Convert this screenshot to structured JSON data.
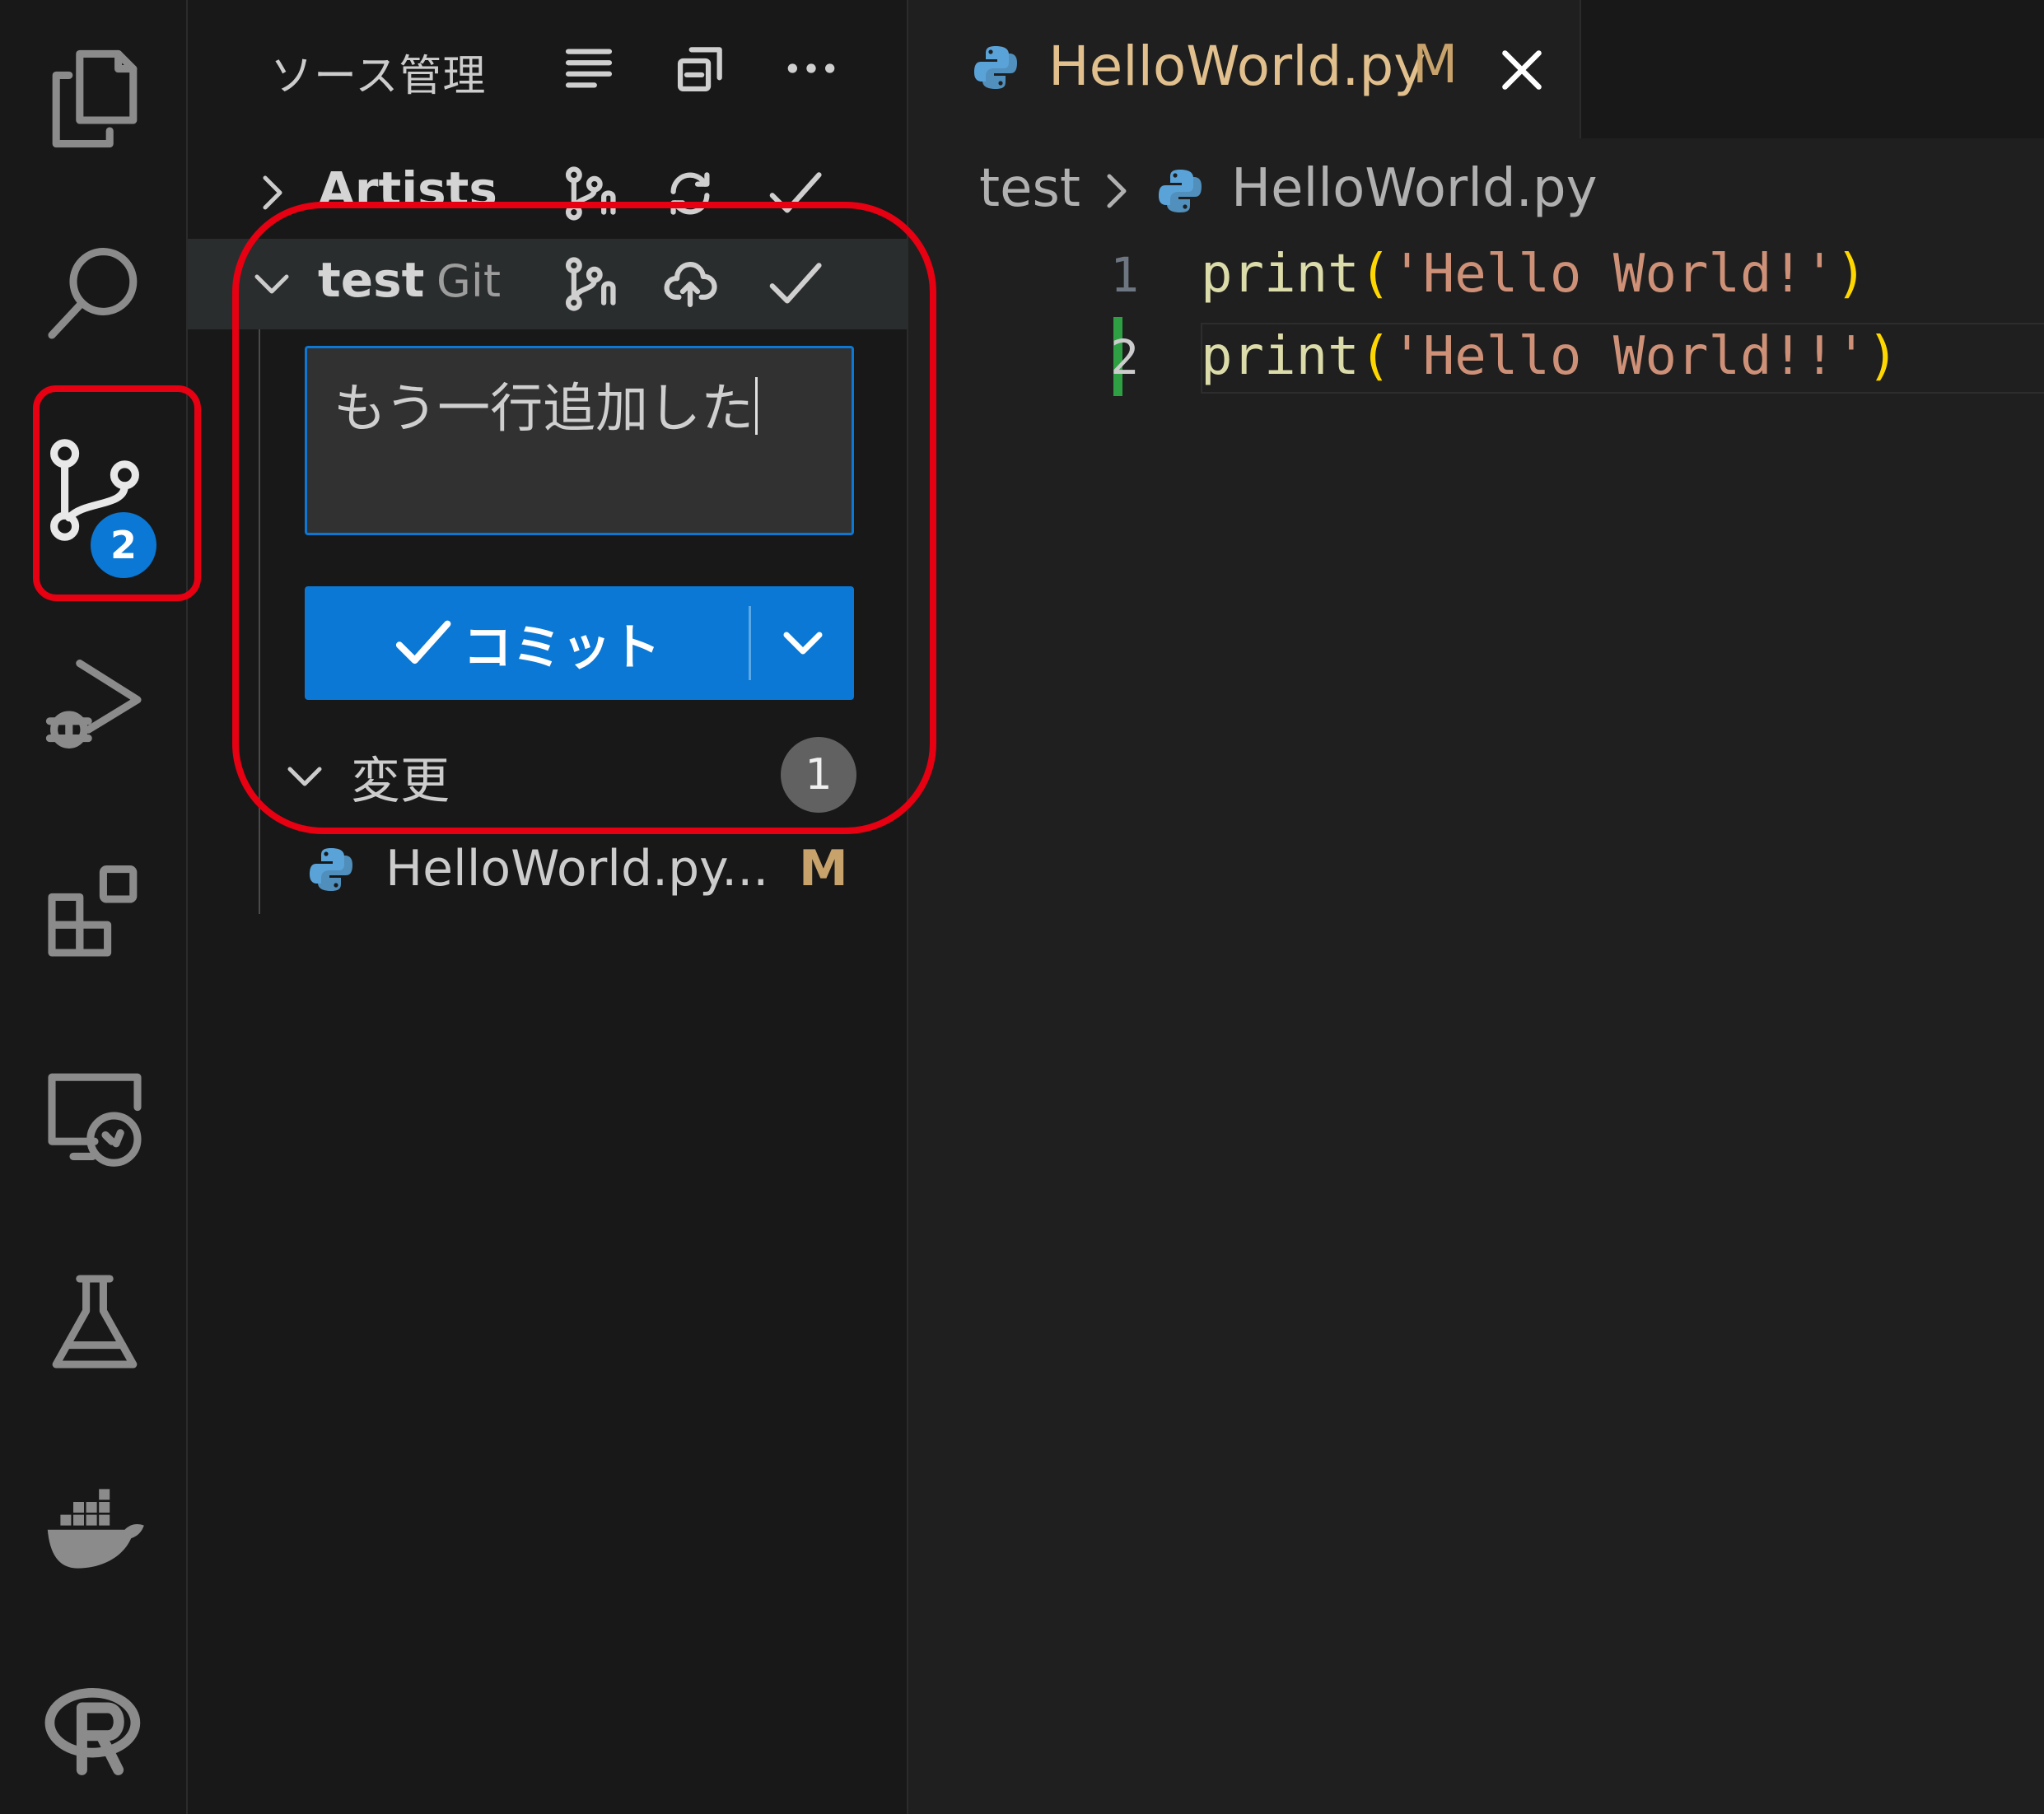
{
  "activity_bar": {
    "items": [
      {
        "name": "explorer",
        "icon": "files-icon"
      },
      {
        "name": "search",
        "icon": "search-icon"
      },
      {
        "name": "source-control",
        "icon": "source-control-icon",
        "badge": "2",
        "active": true
      },
      {
        "name": "run-debug",
        "icon": "debug-icon"
      },
      {
        "name": "extensions",
        "icon": "extensions-icon"
      },
      {
        "name": "remote-explorer",
        "icon": "remote-explorer-icon"
      },
      {
        "name": "testing",
        "icon": "flask-icon"
      },
      {
        "name": "docker",
        "icon": "docker-icon"
      },
      {
        "name": "r",
        "icon": "r-icon"
      }
    ]
  },
  "sidebar": {
    "title": "ソース管理",
    "actions": [
      "list-icon",
      "collapse-all-icon",
      "more-icon"
    ],
    "repos": [
      {
        "name": "Artists",
        "provider": "",
        "expanded": false,
        "actions": [
          "branch-icon",
          "sync-icon",
          "check-icon"
        ]
      },
      {
        "name": "test",
        "provider": "Git",
        "expanded": true,
        "actions": [
          "branch-icon",
          "cloud-upload-icon",
          "check-icon"
        ]
      }
    ],
    "commit_message": "もう一行追加した",
    "commit_button_label": "コミット",
    "changes": {
      "label": "変更",
      "count": "1",
      "files": [
        {
          "name": "HelloWorld.py...",
          "status": "M"
        }
      ]
    }
  },
  "editor": {
    "tab": {
      "name": "HelloWorld.py",
      "modified": "M"
    },
    "breadcrumb": {
      "folder": "test",
      "file": "HelloWorld.py"
    },
    "lines": [
      {
        "number": "1",
        "fn": "print",
        "open": "(",
        "str": "'Hello World!'",
        "close": ")"
      },
      {
        "number": "2",
        "fn": "print",
        "open": "(",
        "str": "'Hello World!!'",
        "close": ")"
      }
    ]
  },
  "colors": {
    "accent": "#0a78d4",
    "annotation": "#e60012",
    "gutter_added": "#2ea043",
    "modified": "#c7a26a"
  }
}
